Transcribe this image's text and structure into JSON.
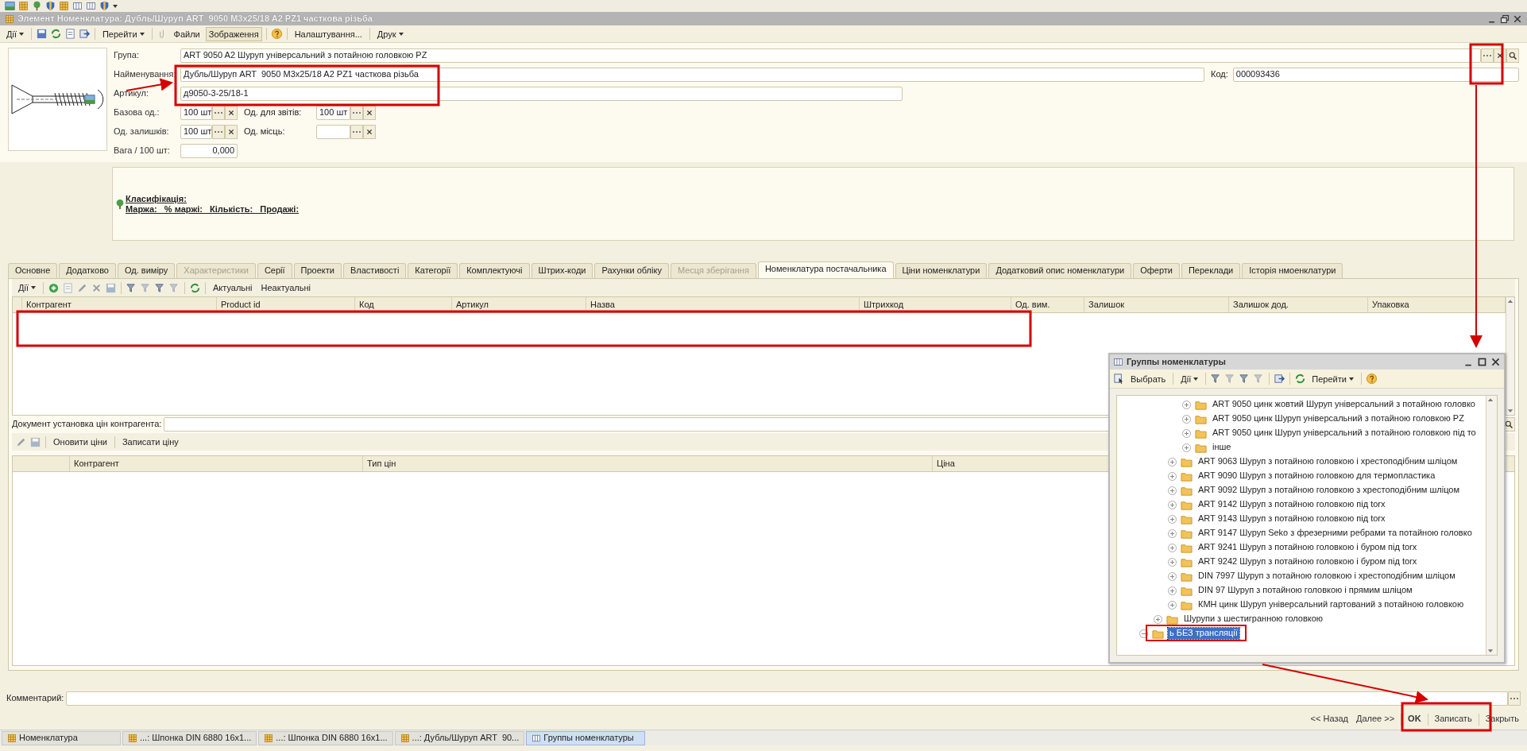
{
  "window": {
    "title": "Элемент Номенклатура: Дубль/Шуруп ART  9050 M3x25/18 A2 PZ1 часткова різьба"
  },
  "toolbar": [
    {
      "kind": "menu",
      "label": "Дії"
    },
    {
      "kind": "menu",
      "label": "Перейти"
    },
    {
      "kind": "button",
      "label": "Файли",
      "pressed": false
    },
    {
      "kind": "button",
      "label": "Зображення",
      "pressed": true
    },
    {
      "kind": "button",
      "label": "Налаштування...",
      "pressed": false
    },
    {
      "kind": "menu",
      "label": "Друк"
    }
  ],
  "form": {
    "group": {
      "label": "Група:",
      "value": "ART 9050 A2 Шуруп універсальний з потайною головкою PZ"
    },
    "name": {
      "label": "Найменування:",
      "value": "Дубль/Шуруп ART  9050 M3x25/18 A2 PZ1 часткова різьба"
    },
    "code": {
      "label": "Код:",
      "value": "000093436"
    },
    "article": {
      "label": "Артикул:",
      "value": "д9050-3-25/18-1"
    },
    "base_unit": {
      "label": "Базова од.:",
      "value": "100 шт"
    },
    "report_unit": {
      "label": "Од. для звітів:",
      "value": "100 шт"
    },
    "stock_unit": {
      "label": "Од. залишків:",
      "value": "100 шт"
    },
    "place_unit": {
      "label": "Од. місць:"
    },
    "weight": {
      "label": "Вага / 100 шт:",
      "value": "0,000"
    }
  },
  "classification": {
    "title": "Класифікація:",
    "metrics": "Маржа:   % маржі:   Кількість:   Продажі:"
  },
  "tabs": [
    {
      "label": "Основне",
      "selected": false,
      "disabled": false
    },
    {
      "label": "Додатково",
      "selected": false,
      "disabled": false
    },
    {
      "label": "Од. виміру",
      "selected": false,
      "disabled": false
    },
    {
      "label": "Характеристики",
      "selected": false,
      "disabled": true
    },
    {
      "label": "Серії",
      "selected": false,
      "disabled": false
    },
    {
      "label": "Проекти",
      "selected": false,
      "disabled": false
    },
    {
      "label": "Властивості",
      "selected": false,
      "disabled": false
    },
    {
      "label": "Категорії",
      "selected": false,
      "disabled": false
    },
    {
      "label": "Комплектуючі",
      "selected": false,
      "disabled": false
    },
    {
      "label": "Штрих-коди",
      "selected": false,
      "disabled": false
    },
    {
      "label": "Рахунки обліку",
      "selected": false,
      "disabled": false
    },
    {
      "label": "Месця зберігання",
      "selected": false,
      "disabled": true
    },
    {
      "label": "Номенклатура постачальника",
      "selected": true,
      "disabled": false
    },
    {
      "label": "Ціни номенклатури",
      "selected": false,
      "disabled": false
    },
    {
      "label": "Додатковий опис номенклатури",
      "selected": false,
      "disabled": false
    },
    {
      "label": "Оферти",
      "selected": false,
      "disabled": false
    },
    {
      "label": "Переклади",
      "selected": false,
      "disabled": false
    },
    {
      "label": "Історія нмоенклатури",
      "selected": false,
      "disabled": false
    }
  ],
  "supplier_toolbar": [
    {
      "kind": "menu",
      "label": "Дії"
    },
    {
      "kind": "button",
      "label": "Актуальні"
    },
    {
      "kind": "button",
      "label": "Неактуальні"
    }
  ],
  "supplier_table": {
    "columns": [
      "Контрагент",
      "Product id",
      "Код",
      "Артикул",
      "Назва",
      "Штрихкод",
      "Од. вим.",
      "Залишок",
      "Залишок дод.",
      "Упаковка"
    ]
  },
  "price_document": {
    "label": "Документ установка цін контрагента:"
  },
  "price_toolbar": [
    {
      "kind": "button",
      "label": "Оновити ціни"
    },
    {
      "kind": "button",
      "label": "Записати ціну"
    }
  ],
  "price_table": {
    "columns": [
      "Контрагент",
      "Тип цін",
      "Ціна"
    ]
  },
  "comment": {
    "label": "Комментарий:"
  },
  "footer_buttons": [
    {
      "label": "<< Назад",
      "default": false
    },
    {
      "label": "Далее >>",
      "default": false
    },
    {
      "label": "OK",
      "default": true
    },
    {
      "label": "Записать",
      "default": false
    },
    {
      "label": "Закрыть",
      "default": false
    }
  ],
  "groups_dialog": {
    "title": "Группы номенклатуры",
    "toolbar": [
      {
        "kind": "button",
        "label": "Выбрать"
      },
      {
        "kind": "menu",
        "label": "Дії"
      },
      {
        "kind": "menu",
        "label": "Перейти"
      }
    ],
    "tree": [
      {
        "children": [
          {
            "children": [
              {
                "children": [
                  {
                    "label": "ART 9050 цинк жовтий Шуруп універсальний з потайною головко",
                    "expanded": false,
                    "selected": false
                  },
                  {
                    "label": "ART 9050 цинк Шуруп універсальний з потайною головкою PZ",
                    "expanded": false,
                    "selected": false
                  },
                  {
                    "label": "ART 9050 цинк Шуруп універсальний з потайною головкою під то",
                    "expanded": false,
                    "selected": false
                  },
                  {
                    "label": "інше",
                    "expanded": false,
                    "selected": false
                  }
                ]
              },
              {
                "label": "ART 9063 Шуруп з потайною головкою і хрестоподібним шліцом",
                "expanded": false,
                "selected": false
              },
              {
                "label": "ART 9090 Шуруп з потайною головкою для термопластика",
                "expanded": false,
                "selected": false
              },
              {
                "label": "ART 9092 Шуруп з потайною головкою з хрестоподібним шліцом",
                "expanded": false,
                "selected": false
              },
              {
                "label": "ART 9142 Шуруп з потайною головкою під torx",
                "expanded": false,
                "selected": false
              },
              {
                "label": "ART 9143 Шуруп з потайною головкою під torx",
                "expanded": false,
                "selected": false
              },
              {
                "label": "ART 9147 Шуруп Seko з фрезерними ребрами та потайною головко",
                "expanded": false,
                "selected": false
              },
              {
                "label": "ART 9241 Шуруп з потайною головкою і буром під torx",
                "expanded": false,
                "selected": false
              },
              {
                "label": "ART 9242 Шуруп з потайною головкою і буром під torx",
                "expanded": false,
                "selected": false
              },
              {
                "label": "DIN 7997 Шуруп з потайною головкою і хрестоподібним шліцом",
                "expanded": false,
                "selected": false
              },
              {
                "label": "DIN 97 Шуруп з потайною головкою і прямим шліцом",
                "expanded": false,
                "selected": false
              },
              {
                "label": "КМН цинк Шуруп універсальний гартований з потайною головкою",
                "expanded": false,
                "selected": false
              }
            ]
          },
          {
            "label": "Шурупи з шестигранною головкою",
            "expanded": false,
            "selected": false
          }
        ]
      },
      {
        "label": "ь БЕЗ трансляції",
        "expanded": true,
        "selected": true
      }
    ]
  },
  "taskbar": [
    {
      "label": "Номенклатура",
      "kind": "folder",
      "selected": false
    },
    {
      "label": "...: Шпонка DIN 6880 16x1...",
      "kind": "folder",
      "selected": false
    },
    {
      "label": "...: Шпонка DIN 6880 16x1...",
      "kind": "folder",
      "selected": false
    },
    {
      "label": "...: Дубль/Шуруп ART  90...",
      "kind": "folder",
      "selected": false
    },
    {
      "label": "Группы номенклатуры",
      "kind": "table",
      "selected": true
    }
  ]
}
